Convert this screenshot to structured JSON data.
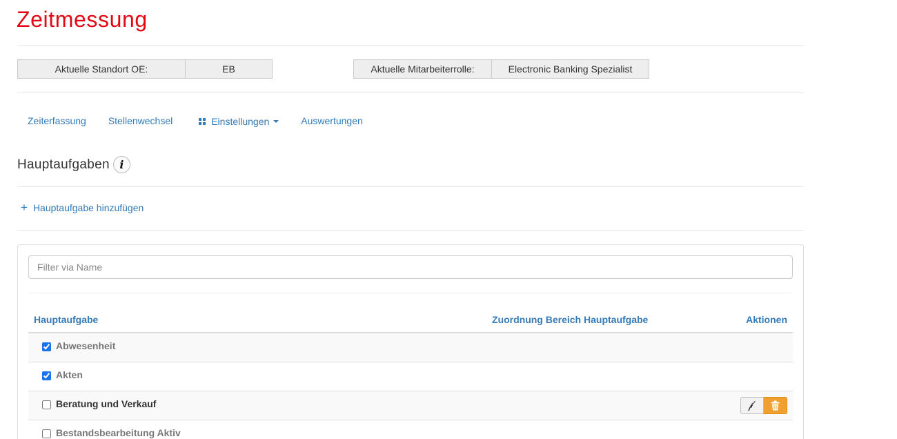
{
  "page": {
    "title": "Zeitmessung"
  },
  "info": {
    "standort_label": "Aktuelle Standort OE:",
    "standort_value": "EB",
    "rolle_label": "Aktuelle Mitarbeiterrolle:",
    "rolle_value": "Electronic Banking Spezialist"
  },
  "nav": {
    "items": [
      "Zeiterfassung",
      "Stellenwechsel",
      "Einstellungen",
      "Auswertungen"
    ]
  },
  "section": {
    "heading": "Hauptaufgaben",
    "info_icon": "info-icon",
    "add_label": "Hauptaufgabe hinzufügen"
  },
  "filter": {
    "placeholder": "Filter via Name",
    "value": ""
  },
  "table": {
    "columns": [
      "Hauptaufgabe",
      "Zuordnung Bereich Hauptaufgabe",
      "Aktionen"
    ],
    "rows": [
      {
        "name": "Abwesenheit",
        "checked": true,
        "has_actions": false
      },
      {
        "name": "Akten",
        "checked": true,
        "has_actions": false
      },
      {
        "name": "Beratung und Verkauf",
        "checked": false,
        "has_actions": true
      },
      {
        "name": "Bestandsbearbeitung Aktiv",
        "checked": false,
        "has_actions": false
      }
    ],
    "action_icons": [
      "feather-edit-icon",
      "trash-icon"
    ]
  },
  "colors": {
    "brand_red": "#e30613",
    "link_blue": "#337ab7",
    "delete_orange": "#f0a030"
  }
}
